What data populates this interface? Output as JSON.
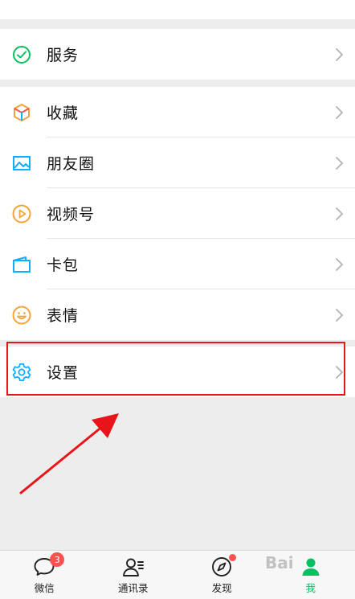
{
  "groups": {
    "service": {
      "items": [
        {
          "label": "服务",
          "icon": "service-icon"
        }
      ]
    },
    "main": {
      "items": [
        {
          "label": "收藏",
          "icon": "favorites-icon"
        },
        {
          "label": "朋友圈",
          "icon": "moments-icon"
        },
        {
          "label": "视频号",
          "icon": "channels-icon"
        },
        {
          "label": "卡包",
          "icon": "card-wallet-icon"
        },
        {
          "label": "表情",
          "icon": "sticker-icon"
        }
      ]
    },
    "settings": {
      "items": [
        {
          "label": "设置",
          "icon": "settings-icon"
        }
      ]
    }
  },
  "tabbar": {
    "tabs": [
      {
        "label": "微信",
        "icon": "chat-icon",
        "badge": "3"
      },
      {
        "label": "通讯录",
        "icon": "contacts-icon"
      },
      {
        "label": "发现",
        "icon": "discover-icon",
        "dot": true
      },
      {
        "label": "我",
        "icon": "me-icon",
        "active": true
      }
    ]
  },
  "watermark": "Bai",
  "colors": {
    "accent": "#07c160",
    "highlight": "#e8141a",
    "badge": "#fa5151"
  }
}
